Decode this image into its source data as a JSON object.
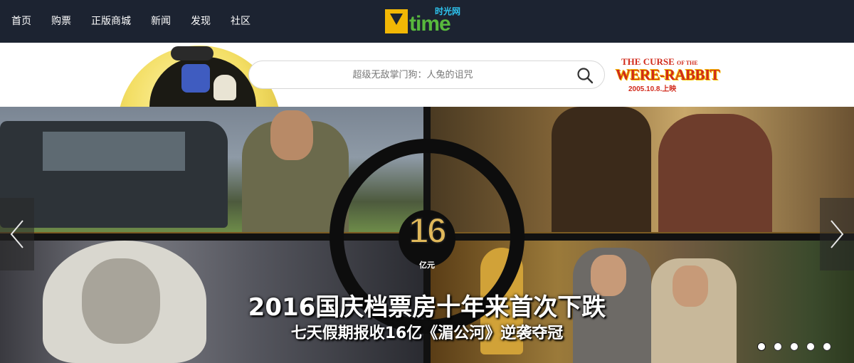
{
  "nav": {
    "items": [
      {
        "label": "首页"
      },
      {
        "label": "购票"
      },
      {
        "label": "正版商城"
      },
      {
        "label": "新闻"
      },
      {
        "label": "发现"
      },
      {
        "label": "社区"
      }
    ]
  },
  "logo": {
    "text": "time",
    "cn": "时光网"
  },
  "search": {
    "placeholder": "超级无敌掌门狗：人兔的诅咒",
    "icon": "search-icon"
  },
  "promo": {
    "line1_a": "THE CURSE",
    "line1_b": "OF THE",
    "line2": "WERE-RABBIT",
    "line3": "2005.10.8.上映"
  },
  "hero": {
    "badge_number": "16",
    "badge_unit": "亿元",
    "headline": "2016国庆档票房十年来首次下跌",
    "subline": "七天假期报收16亿《湄公河》逆袭夺冠",
    "slide_count": 5,
    "active_slide": 1
  },
  "colors": {
    "topbar": "#1c2331",
    "logo_green": "#58b93d",
    "logo_yellow": "#f2b705",
    "badge_gold": "#e0b85a"
  }
}
